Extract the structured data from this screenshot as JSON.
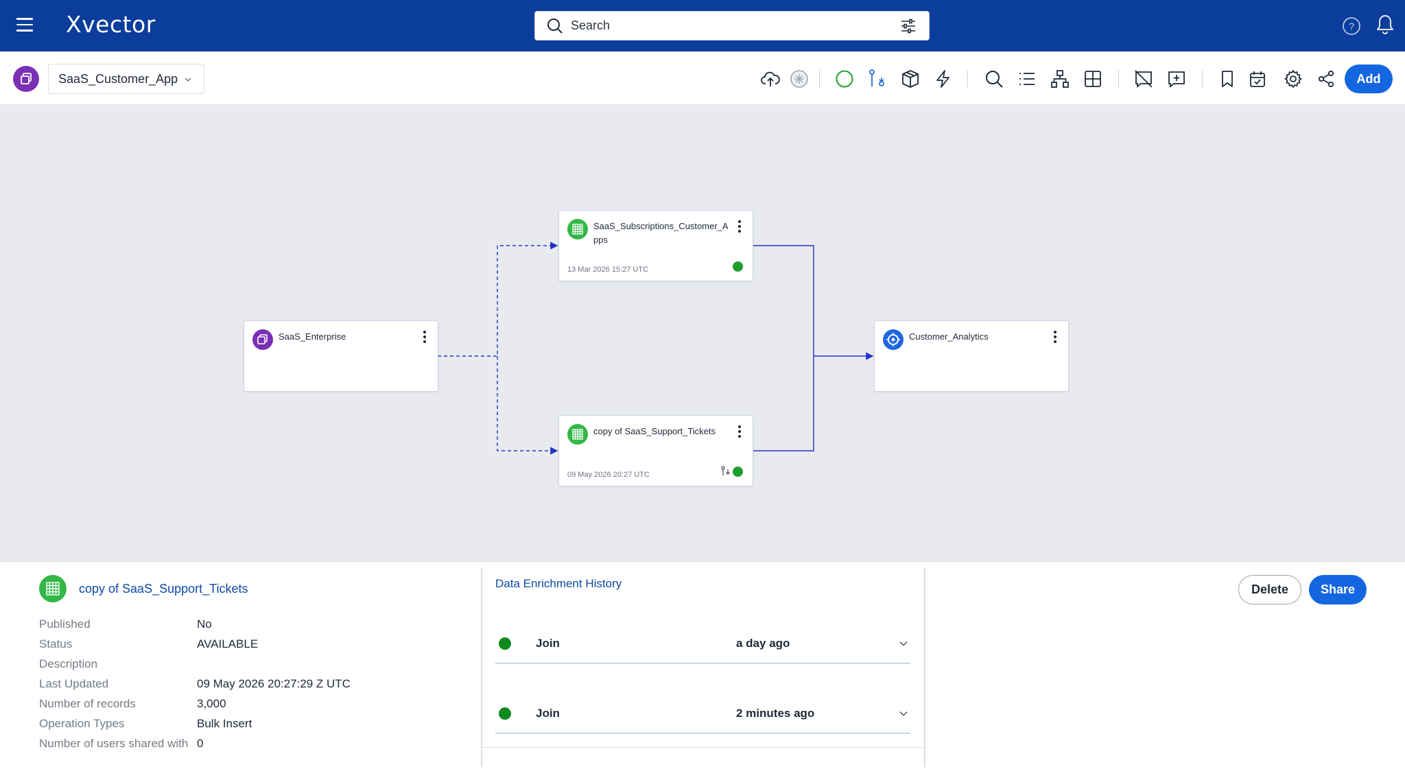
{
  "header": {
    "brand": "Xvector",
    "search_placeholder": "Search"
  },
  "toolbar": {
    "app_name": "SaaS_Customer_App",
    "add_label": "Add"
  },
  "graph": {
    "nodes": {
      "enterprise": {
        "title": "SaaS_Enterprise"
      },
      "subscriptions": {
        "title": "SaaS_Subscriptions_Customer_Apps",
        "date": "13 Mar 2026 15:27 UTC"
      },
      "support": {
        "title": "copy of SaaS_Support_Tickets",
        "date": "09 May 2026 20:27 UTC"
      },
      "analytics": {
        "title": "Customer_Analytics"
      }
    }
  },
  "details": {
    "title": "copy of SaaS_Support_Tickets",
    "fields": [
      {
        "label": "Published",
        "value": "No"
      },
      {
        "label": "Status",
        "value": "AVAILABLE"
      },
      {
        "label": "Description",
        "value": ""
      },
      {
        "label": "Last Updated",
        "value": "09 May 2026 20:27:29 Z UTC"
      },
      {
        "label": "Number of records",
        "value": "3,000"
      },
      {
        "label": "Operation Types",
        "value": "Bulk Insert"
      },
      {
        "label": "Number of users shared with",
        "value": "0"
      }
    ],
    "delete_label": "Delete",
    "share_label": "Share"
  },
  "history": {
    "title": "Data Enrichment History",
    "items": [
      {
        "type": "Join",
        "time": "a day ago"
      },
      {
        "type": "Join",
        "time": "2 minutes ago"
      }
    ]
  },
  "colors": {
    "header_bg": "#0a3d9c",
    "accent": "#1466e0",
    "status_green": "#1e9e2e",
    "edge_blue": "#2233cc"
  }
}
